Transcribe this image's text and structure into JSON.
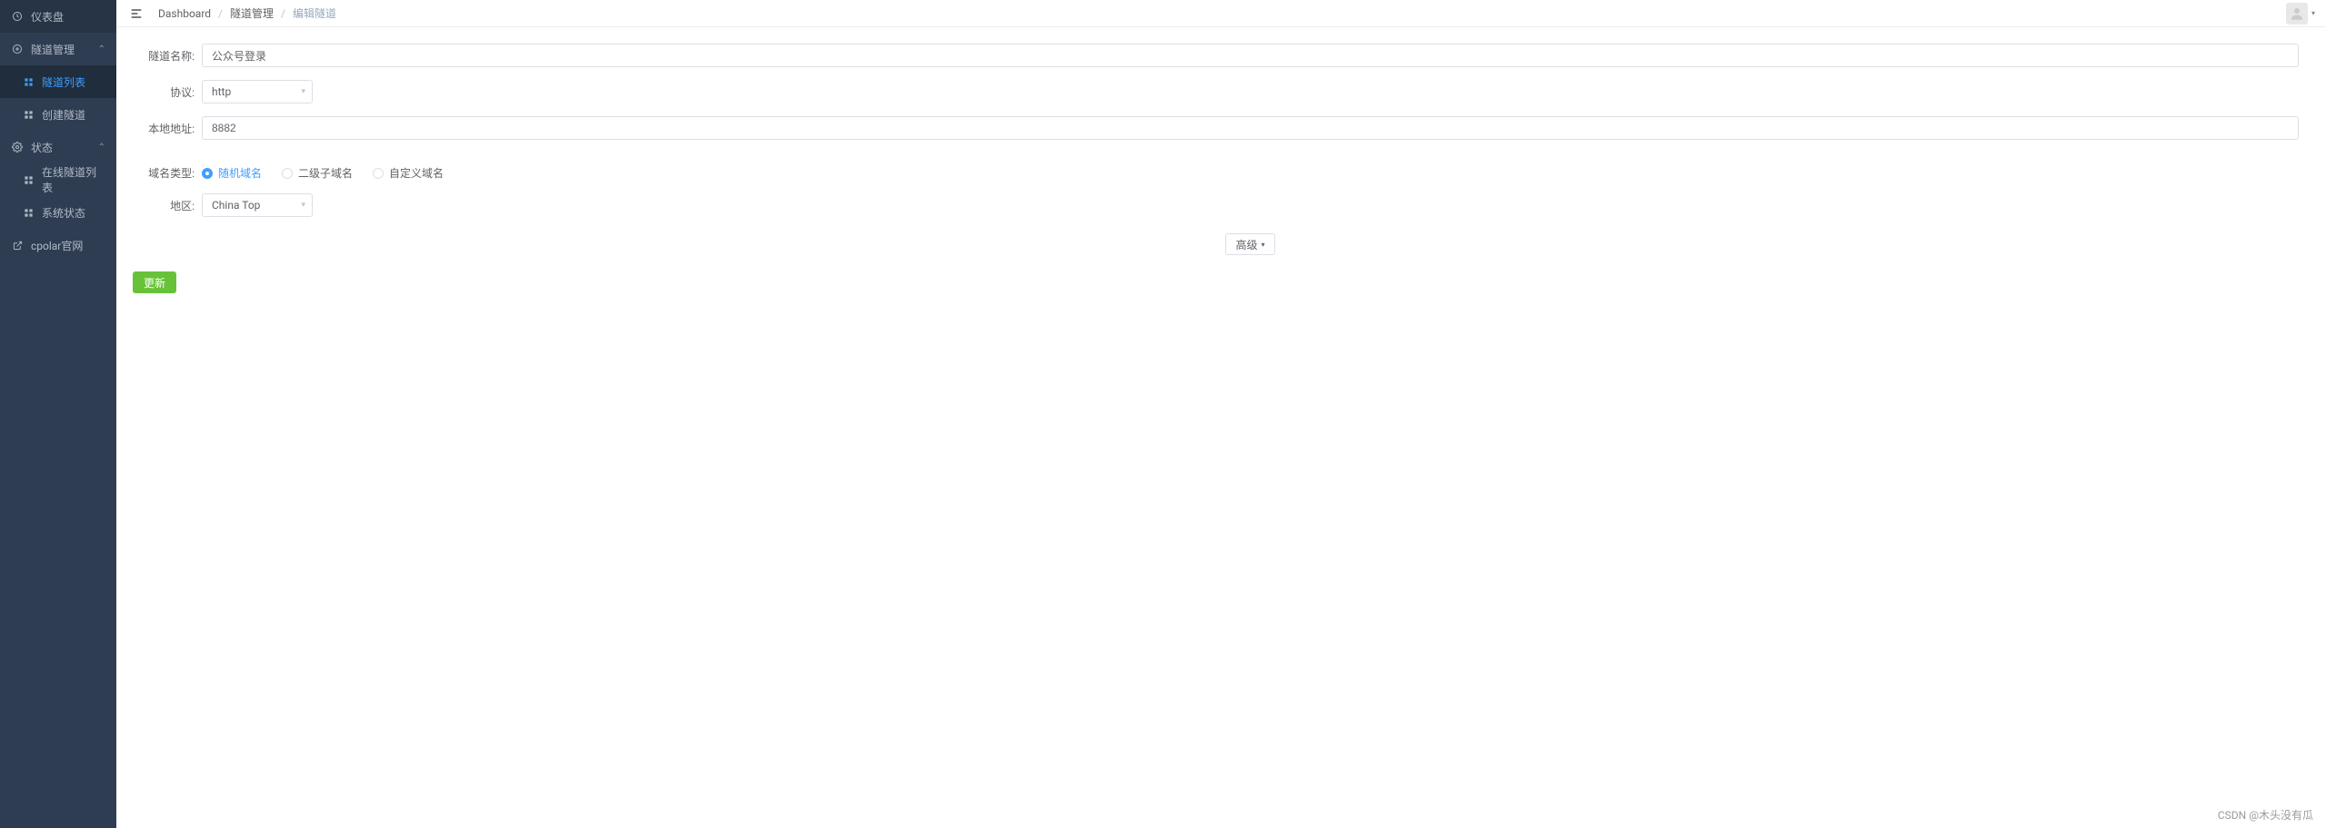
{
  "sidebar": {
    "items": [
      {
        "icon": "dashboard-icon",
        "label": "仪表盘",
        "type": "item"
      },
      {
        "icon": "plus-circle-icon",
        "label": "隧道管理",
        "type": "group",
        "expanded": true
      },
      {
        "icon": "grid-icon",
        "label": "隧道列表",
        "type": "sub",
        "active": true
      },
      {
        "icon": "grid-icon",
        "label": "创建隧道",
        "type": "sub"
      },
      {
        "icon": "gear-icon",
        "label": "状态",
        "type": "group",
        "expanded": true
      },
      {
        "icon": "grid-icon",
        "label": "在线隧道列表",
        "type": "sub"
      },
      {
        "icon": "grid-icon",
        "label": "系统状态",
        "type": "sub"
      },
      {
        "icon": "external-link-icon",
        "label": "cpolar官网",
        "type": "item"
      }
    ]
  },
  "breadcrumb": {
    "items": [
      "Dashboard",
      "隧道管理",
      "编辑隧道"
    ]
  },
  "form": {
    "tunnel_name": {
      "label": "隧道名称:",
      "value": "公众号登录"
    },
    "protocol": {
      "label": "协议:",
      "value": "http"
    },
    "local_addr": {
      "label": "本地地址:",
      "value": "8882"
    },
    "domain_type": {
      "label": "域名类型:",
      "options": [
        "随机域名",
        "二级子域名",
        "自定义域名"
      ],
      "selected": 0
    },
    "region": {
      "label": "地区:",
      "value": "China Top"
    },
    "advanced_label": "高级",
    "submit_label": "更新"
  },
  "watermark": "CSDN @木头没有瓜"
}
